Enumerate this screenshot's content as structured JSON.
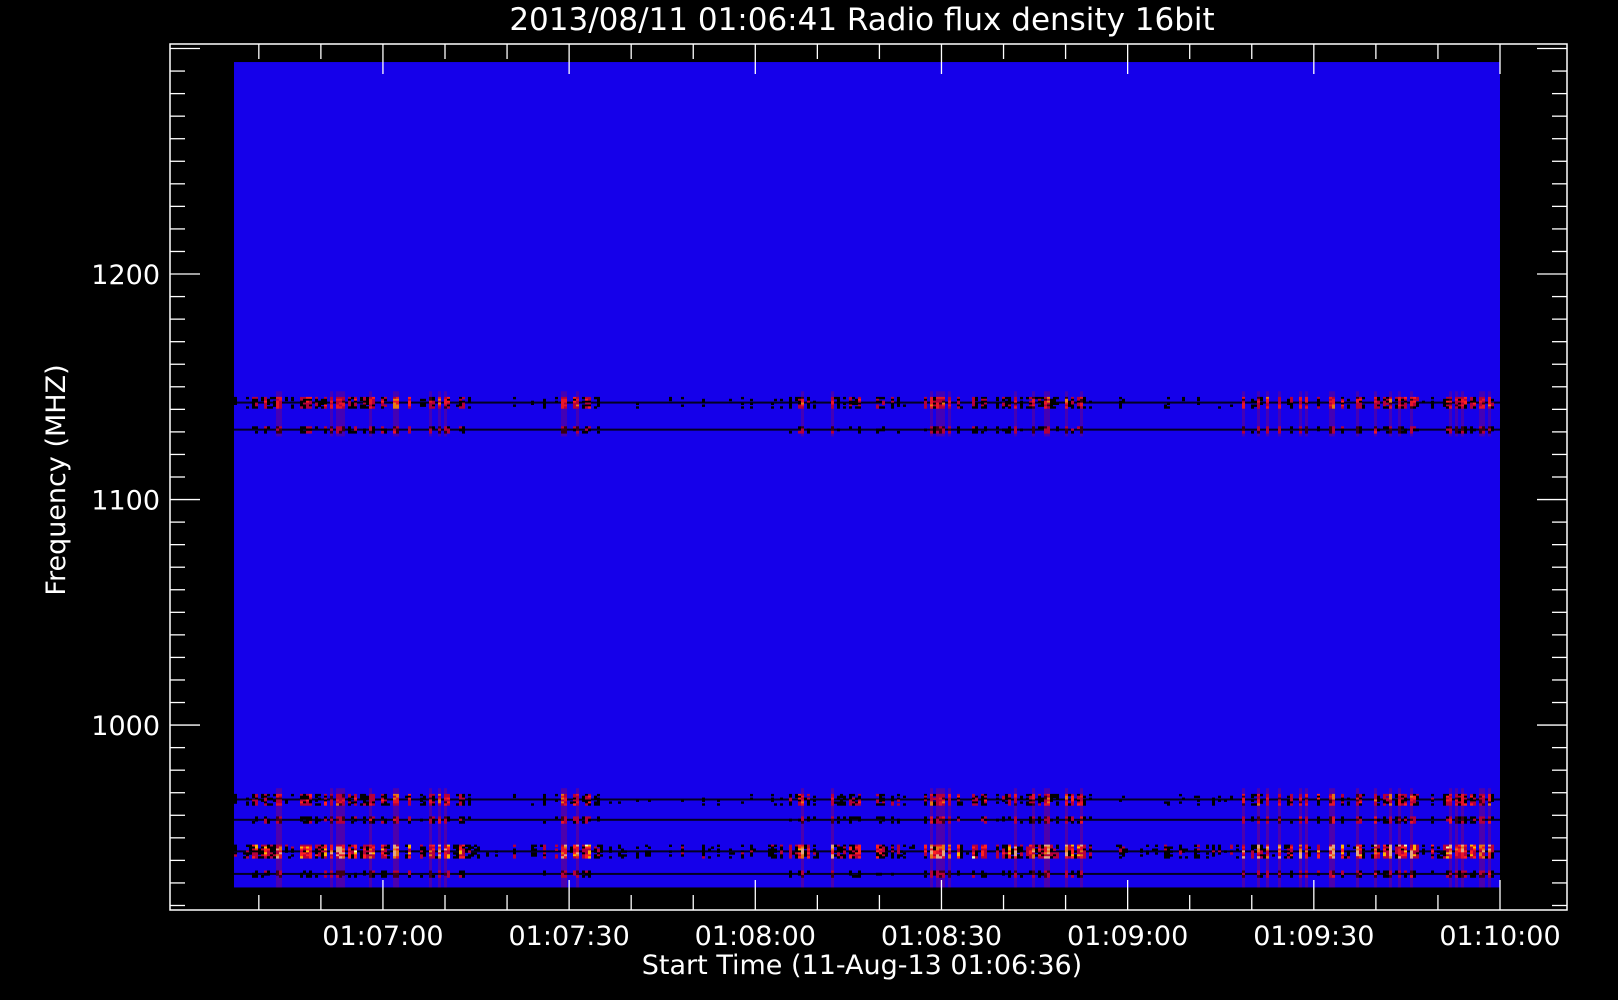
{
  "chart_data": {
    "type": "heatmap",
    "title": "2013/08/11 01:06:41 Radio flux density 16bit",
    "xlabel": "Start Time (11-Aug-13 01:06:36)",
    "ylabel": "Frequency (MHZ)",
    "x_start": "01:06:36",
    "x_tick_labels": [
      "01:07:00",
      "01:07:30",
      "01:08:00",
      "01:08:30",
      "01:09:00",
      "01:09:30",
      "01:10:00"
    ],
    "y_tick_labels": [
      "1000",
      "1100",
      "1200"
    ],
    "y_ticks": [
      1000,
      1100,
      1200
    ],
    "ylim": [
      918,
      1302
    ],
    "data_freq_range": [
      928,
      1294
    ],
    "background_color": "#1500ea",
    "palette": [
      "#1500ea",
      "#000000",
      "#b4003c",
      "#ff2020",
      "#ffb400",
      "#ffffa0"
    ],
    "interference_bands_mhz": [
      {
        "freq": 1143,
        "width": 5,
        "strength": 0.75
      },
      {
        "freq": 1131,
        "width": 3,
        "strength": 0.55
      },
      {
        "freq": 967,
        "width": 5,
        "strength": 0.75
      },
      {
        "freq": 958,
        "width": 3,
        "strength": 0.6
      },
      {
        "freq": 944,
        "width": 6,
        "strength": 1.0
      },
      {
        "freq": 934,
        "width": 3,
        "strength": 0.55
      }
    ]
  }
}
